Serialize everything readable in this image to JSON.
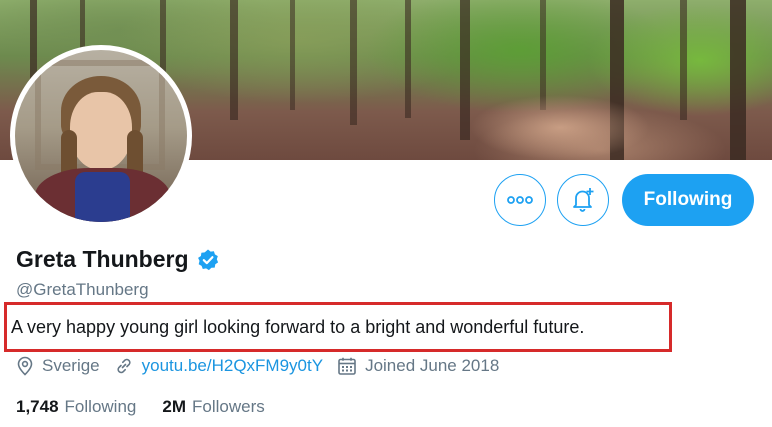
{
  "profile": {
    "display_name": "Greta Thunberg",
    "handle": "@GretaThunberg",
    "bio": "A very happy young girl looking forward to a bright and wonderful future.",
    "location": "Sverige",
    "website": "youtu.be/H2QxFM9y0tY",
    "joined": "Joined June 2018"
  },
  "actions": {
    "follow_state_label": "Following"
  },
  "stats": {
    "following_count": "1,748",
    "following_label": "Following",
    "followers_count": "2M",
    "followers_label": "Followers"
  },
  "icons": {
    "more": "more-icon",
    "notify": "bell-plus-icon",
    "verified": "verified-badge-icon",
    "location": "location-pin-icon",
    "link": "link-icon",
    "calendar": "calendar-icon"
  },
  "colors": {
    "accent": "#1da1f2",
    "link": "#1b95e0",
    "secondary_text": "#657786",
    "highlight_box": "#d62a2a"
  }
}
